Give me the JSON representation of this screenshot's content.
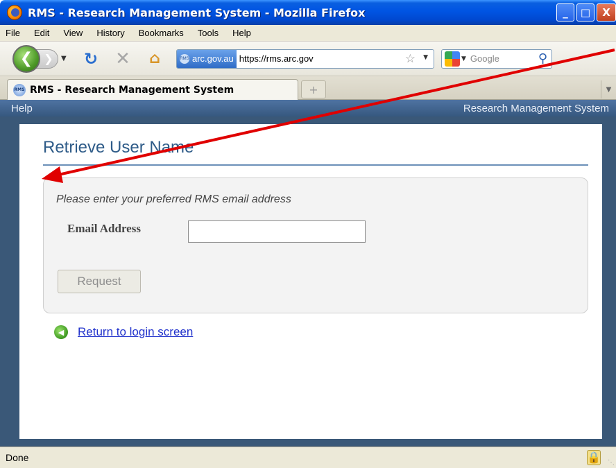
{
  "window": {
    "title": "RMS - Research Management System - Mozilla Firefox",
    "minimize_glyph": "_",
    "maximize_glyph": "□",
    "close_glyph": "X"
  },
  "menu": {
    "items": [
      "File",
      "Edit",
      "View",
      "History",
      "Bookmarks",
      "Tools",
      "Help"
    ]
  },
  "navbar": {
    "site_identity": "arc.gov.au",
    "url": "https://rms.arc.gov",
    "search_placeholder": "Google"
  },
  "tabs": {
    "active_label": "RMS - Research Management System",
    "favicon_text": "RMS",
    "new_tab_glyph": "+"
  },
  "page": {
    "help_link": "Help",
    "system_name": "Research Management System",
    "title": "Retrieve User Name",
    "instructions": "Please enter your preferred RMS email address",
    "email_label": "Email Address",
    "email_value": "",
    "request_button": "Request",
    "return_link": "Return to login screen"
  },
  "status": {
    "text": "Done"
  },
  "colors": {
    "titlebar": "#0054e3",
    "help_bar": "#36587f",
    "page_title": "#2e5b88",
    "link": "#2233cc",
    "annotation_arrow": "#e00000"
  }
}
